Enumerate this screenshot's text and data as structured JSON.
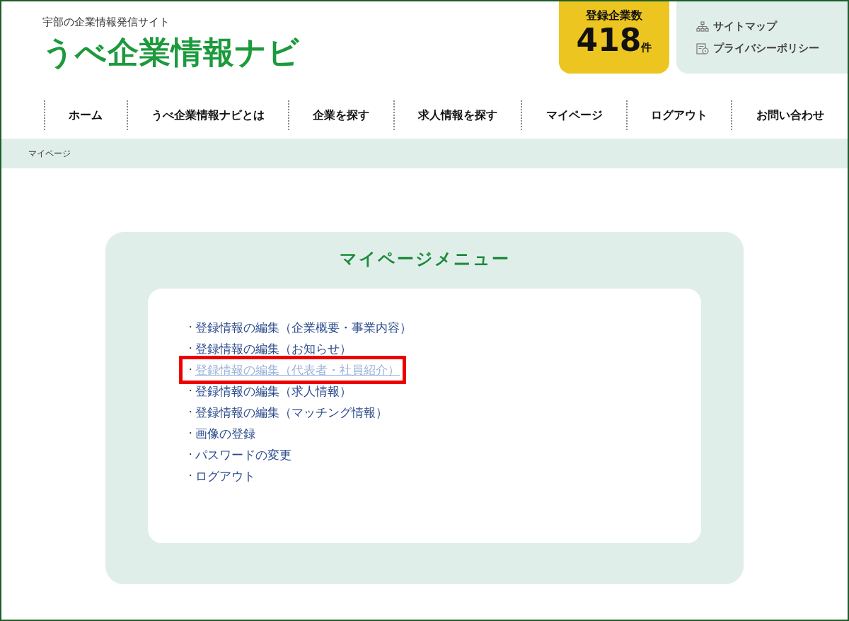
{
  "header": {
    "tagline": "宇部の企業情報発信サイト",
    "logo": "うべ企業情報ナビ",
    "count_label": "登録企業数",
    "count_value": "418",
    "count_unit": "件",
    "utility_links": [
      {
        "kind": "sitemap",
        "label": "サイトマップ"
      },
      {
        "kind": "privacy",
        "label": "プライバシーポリシー"
      }
    ]
  },
  "nav": [
    {
      "label": "ホーム"
    },
    {
      "label": "うべ企業情報ナビとは"
    },
    {
      "label": "企業を探す"
    },
    {
      "label": "求人情報を探す"
    },
    {
      "label": "マイページ"
    },
    {
      "label": "ログアウト"
    },
    {
      "label": "お問い合わせ"
    }
  ],
  "breadcrumb": "マイページ",
  "menu": {
    "title": "マイページメニュー",
    "items": [
      {
        "bullet": "・",
        "label": "登録情報の編集（企業概要・事業内容）",
        "hovered": false,
        "highlighted": false
      },
      {
        "bullet": "・",
        "label": "登録情報の編集（お知らせ）",
        "hovered": false,
        "highlighted": false
      },
      {
        "bullet": "・",
        "label": "登録情報の編集（代表者・社員紹介）",
        "hovered": true,
        "highlighted": true
      },
      {
        "bullet": "・",
        "label": "登録情報の編集（求人情報）",
        "hovered": false,
        "highlighted": false
      },
      {
        "bullet": "・",
        "label": "登録情報の編集（マッチング情報）",
        "hovered": false,
        "highlighted": false
      },
      {
        "bullet": "・",
        "label": "画像の登録",
        "hovered": false,
        "highlighted": false
      },
      {
        "bullet": "・",
        "label": "パスワードの変更",
        "hovered": false,
        "highlighted": false
      },
      {
        "bullet": "・",
        "label": "ログアウト",
        "hovered": false,
        "highlighted": false
      }
    ]
  }
}
